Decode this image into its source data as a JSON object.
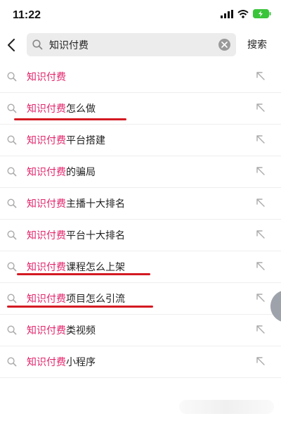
{
  "status_bar": {
    "time": "11:22"
  },
  "search": {
    "query": "知识付费",
    "submit_label": "搜索"
  },
  "keyword": "知识付费",
  "suggestions": [
    {
      "suffix": ""
    },
    {
      "suffix": "怎么做"
    },
    {
      "suffix": "平台搭建"
    },
    {
      "suffix": "的骗局"
    },
    {
      "suffix": "主播十大排名"
    },
    {
      "suffix": "平台十大排名"
    },
    {
      "suffix": "课程怎么上架"
    },
    {
      "suffix": "项目怎么引流"
    },
    {
      "suffix": "类视频"
    },
    {
      "suffix": "小程序"
    }
  ],
  "colors": {
    "keyword": "#e2236a",
    "annotation_underline": "#d41a22",
    "battery": "#3ac43a"
  }
}
